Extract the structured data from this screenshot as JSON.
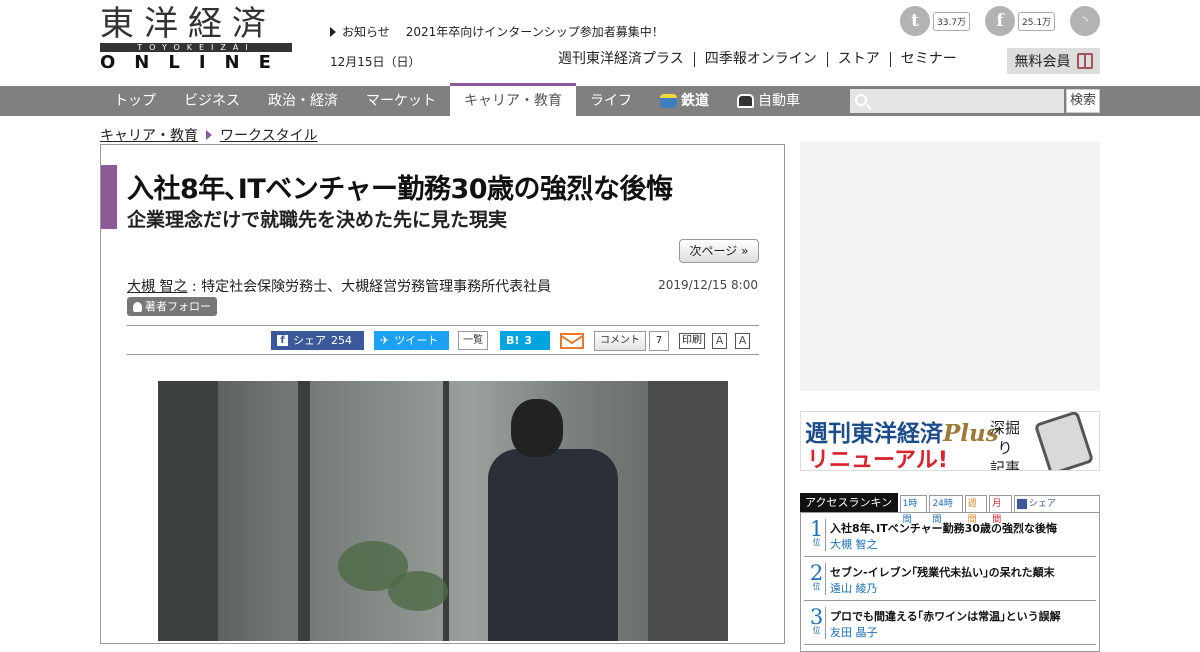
{
  "header": {
    "logo_kanji": "東洋経済",
    "logo_romaji": "TOYOKEIZAI",
    "logo_online": "ONLINE",
    "notice_label": "お知らせ",
    "notice_text": "2021年卒向けインターンシップ参加者募集中！",
    "date": "12月15日（日）",
    "twitter_count": "33.7万",
    "facebook_count": "25.1万",
    "links": [
      "週刊東洋経済プラス",
      "四季報オンライン",
      "ストア",
      "セミナー"
    ],
    "member_label": "無料会員"
  },
  "nav": {
    "items": [
      "トップ",
      "ビジネス",
      "政治・経済",
      "マーケット",
      "キャリア・教育",
      "ライフ",
      "鉄道",
      "自動車"
    ],
    "active_index": 4,
    "search_button": "検索"
  },
  "breadcrumb": [
    "キャリア・教育",
    "ワークスタイル"
  ],
  "article": {
    "title": "入社8年､ITベンチャー勤務30歳の強烈な後悔",
    "subtitle": "企業理念だけで就職先を決めた先に見た現実",
    "next_page": "次ページ »",
    "author_name": "大槻 智之",
    "author_title": " : 特定社会保険労務士、大槻経営労務管理事務所代表社員",
    "date": "2019/12/15 8:00",
    "follow_label": "著者フォロー",
    "share": {
      "facebook_label": "シェア",
      "facebook_count": "254",
      "tweet_label": "ツイート",
      "list_label": "一覧",
      "hatena_label": "B!",
      "hatena_count": "3",
      "comment_label": "コメント",
      "comment_count": "7",
      "print_label": "印刷",
      "font_small": "A",
      "font_large": "A"
    }
  },
  "sidebar": {
    "plus_title_main": "週刊東洋経済",
    "plus_title_brand": "Plus",
    "plus_renew": "リニューアル!",
    "plus_side_lines": [
      "深掘り",
      "記事満載"
    ],
    "ranking_label": "アクセスランキング",
    "ranking_tabs": [
      "1時間",
      "24時間",
      "週間",
      "月間",
      "シェア"
    ],
    "ranking": [
      {
        "num": "1",
        "unit": "位",
        "title": "入社8年､ITベンチャー勤務30歳の強烈な後悔",
        "author": "大槻 智之"
      },
      {
        "num": "2",
        "unit": "位",
        "title": "セブン-イレブン｢残業代未払い｣の呆れた顛末",
        "author": "遠山 綾乃"
      },
      {
        "num": "3",
        "unit": "位",
        "title": "プロでも間違える｢赤ワインは常温｣という誤解",
        "author": "友田 晶子"
      }
    ]
  },
  "colors": {
    "accent": "#8a5b96",
    "nav_bg": "#808080",
    "facebook": "#3b5998",
    "twitter": "#1da1f2",
    "hatena": "#00a4de",
    "rank_blue": "#1d6fb8"
  }
}
